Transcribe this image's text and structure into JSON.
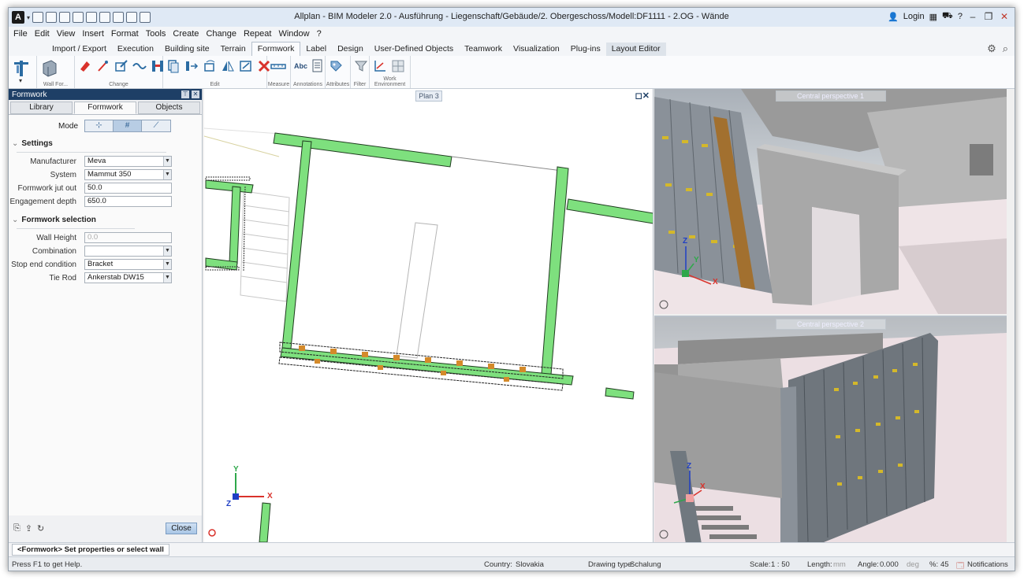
{
  "window": {
    "title": "Allplan - BIM Modeler 2.0 - Ausführung - Liegenschaft/Gebäude/2. Obergeschoss/Modell:DF1111 - 2.OG - Wände",
    "login_label": "Login"
  },
  "menu": [
    "File",
    "Edit",
    "View",
    "Insert",
    "Format",
    "Tools",
    "Create",
    "Change",
    "Repeat",
    "Window",
    "?"
  ],
  "ribbon_tabs": [
    "Import / Export",
    "Execution",
    "Building site",
    "Terrain",
    "Formwork",
    "Label",
    "Design",
    "User-Defined Objects",
    "Teamwork",
    "Visualization",
    "Plug-ins",
    "Layout Editor"
  ],
  "ribbon_groups": {
    "wall_for": "Wall For...",
    "change": "Change",
    "edit": "Edit",
    "measure": "Measure",
    "annotations": "Annotations",
    "attributes": "Attributes",
    "filter": "Filter",
    "work_environment": "Work Environment",
    "abc": "Abc"
  },
  "panel": {
    "title": "Formwork",
    "tabs": [
      "Library",
      "Formwork",
      "Objects"
    ],
    "mode_label": "Mode",
    "settings_header": "Settings",
    "manufacturer_label": "Manufacturer",
    "manufacturer_value": "Meva",
    "system_label": "System",
    "system_value": "Mammut 350",
    "jut_label": "Formwork jut out",
    "jut_value": "50.0",
    "depth_label": "Engagement depth",
    "depth_value": "650.0",
    "selection_header": "Formwork selection",
    "wall_height_label": "Wall Height",
    "wall_height_value": "0.0",
    "combination_label": "Combination",
    "combination_value": "",
    "stop_end_label": "Stop end condition",
    "stop_end_value": "Bracket",
    "tie_rod_label": "Tie Rod",
    "tie_rod_value": "Ankerstab DW15",
    "close_label": "Close"
  },
  "viewports": {
    "plan": "Plan 3",
    "persp1": "Central perspective 1",
    "persp2": "Central perspective 2"
  },
  "axes": {
    "x": "X",
    "y": "Y",
    "z": "Z"
  },
  "prompt": "<Formwork> Set properties or select wall",
  "status": {
    "help": "Press F1 to get Help.",
    "country_label": "Country:",
    "country_value": "Slovakia",
    "drawing_label": "Drawing type:",
    "drawing_value": "Schalung",
    "scale_label": "Scale:",
    "scale_value": "1 : 50",
    "length_label": "Length:",
    "length_unit": "mm",
    "angle_label": "Angle:",
    "angle_value": "0.000",
    "angle_unit": "deg",
    "percent_label": "%:",
    "percent_value": "45",
    "notifications": "Notifications"
  },
  "colors": {
    "wall_green": "#7ee07e",
    "panel_header": "#1e3f66",
    "titlebar": "#dfe9f5"
  }
}
